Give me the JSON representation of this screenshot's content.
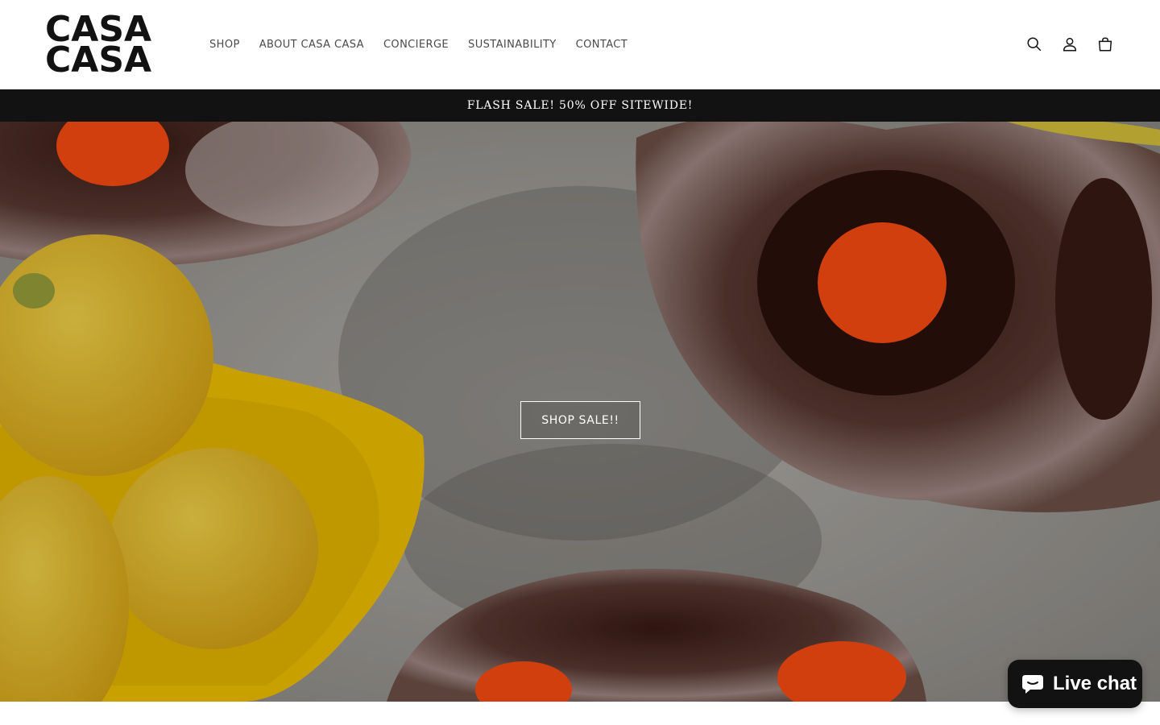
{
  "header": {
    "logo_line1": "CASA",
    "logo_line2": "CASA",
    "nav": [
      {
        "label": "SHOP"
      },
      {
        "label": "ABOUT CASA CASA"
      },
      {
        "label": "CONCIERGE"
      },
      {
        "label": "SUSTAINABILITY"
      },
      {
        "label": "CONTACT"
      }
    ],
    "icons": [
      "search-icon",
      "account-icon",
      "cart-icon"
    ]
  },
  "announcement": {
    "text": "FLASH SALE! 50% OFF SITEWIDE!"
  },
  "hero": {
    "cta_label": "SHOP SALE!!"
  },
  "chat": {
    "label": "Live chat",
    "icon": "chat-bubble-icon"
  },
  "colors": {
    "announcement_bg": "#121212",
    "chat_bg": "#121212",
    "lemon": "#f2c21b",
    "bowl_yellow": "#f4c400",
    "glaze_orange": "#ff4d12"
  }
}
